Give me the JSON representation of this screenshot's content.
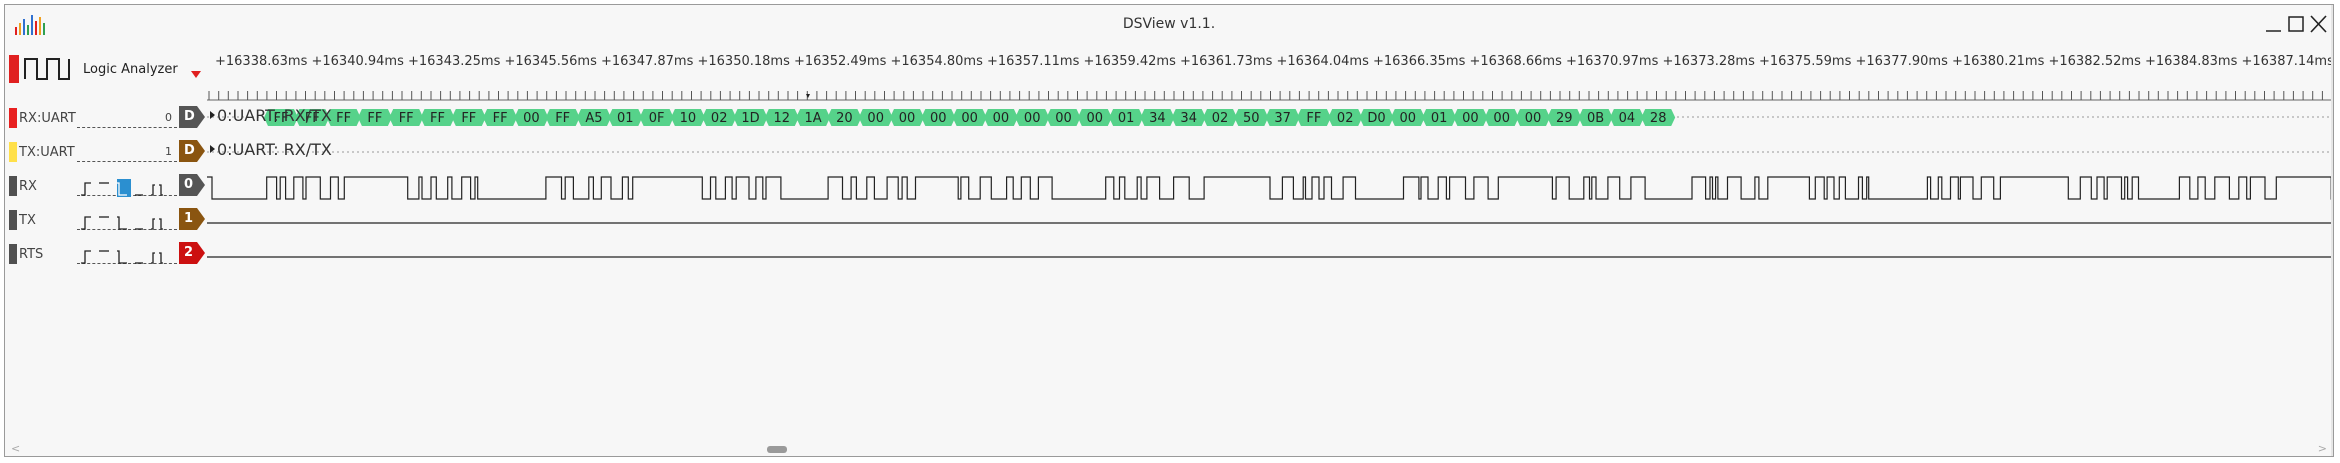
{
  "window": {
    "title": "DSView v1.1.",
    "minimize_label": "_",
    "maximize_label": "☐",
    "close_label": "✕"
  },
  "device": {
    "label": "Logic Analyzer",
    "badge_color": "#e02020"
  },
  "ruler": {
    "tick_labels": [
      "+16338.63ms",
      "+16340.94ms",
      "+16343.25ms",
      "+16345.56ms",
      "+16347.87ms",
      "+16350.18ms",
      "+16352.49ms",
      "+16354.80ms",
      "+16357.11ms",
      "+16359.42ms",
      "+16361.73ms",
      "+16364.04ms",
      "+16366.35ms",
      "+16368.66ms",
      "+16370.97ms",
      "+16373.28ms",
      "+16375.59ms",
      "+16377.90ms",
      "+16380.21ms",
      "+16382.52ms",
      "+16384.83ms",
      "+16387.14ms"
    ]
  },
  "channels": [
    {
      "name": "RX:UART",
      "number": "0",
      "tag": "D",
      "tag_color": "#555555",
      "color": "#e82020",
      "kind": "decoder"
    },
    {
      "name": "TX:UART",
      "number": "1",
      "tag": "D",
      "tag_color": "#8a5510",
      "color": "#ffe04a",
      "kind": "decoder"
    },
    {
      "name": "RX",
      "number": "",
      "tag": "0",
      "tag_color": "#555555",
      "color": "#505050",
      "kind": "logic"
    },
    {
      "name": "TX",
      "number": "",
      "tag": "1",
      "tag_color": "#8a5510",
      "color": "#505050",
      "kind": "logic"
    },
    {
      "name": "RTS",
      "number": "",
      "tag": "2",
      "tag_color": "#cc1010",
      "color": "#505050",
      "kind": "logic"
    }
  ],
  "decoders": {
    "rx_label": "0:UART: RX/TX",
    "tx_label": "0:UART: RX/TX",
    "rx_bytes": [
      "FF",
      "FF",
      "FF",
      "FF",
      "FF",
      "FF",
      "FF",
      "FF",
      "00",
      "FF",
      "A5",
      "01",
      "0F",
      "10",
      "02",
      "1D",
      "12",
      "1A",
      "20",
      "00",
      "00",
      "00",
      "00",
      "00",
      "00",
      "00",
      "00",
      "01",
      "34",
      "34",
      "02",
      "50",
      "37",
      "FF",
      "02",
      "D0",
      "00",
      "01",
      "00",
      "00",
      "00",
      "29",
      "0B",
      "04",
      "28"
    ],
    "byte_color": "#56d28a"
  },
  "colors": {
    "wave": "#222222",
    "dotted_line": "#999999"
  }
}
